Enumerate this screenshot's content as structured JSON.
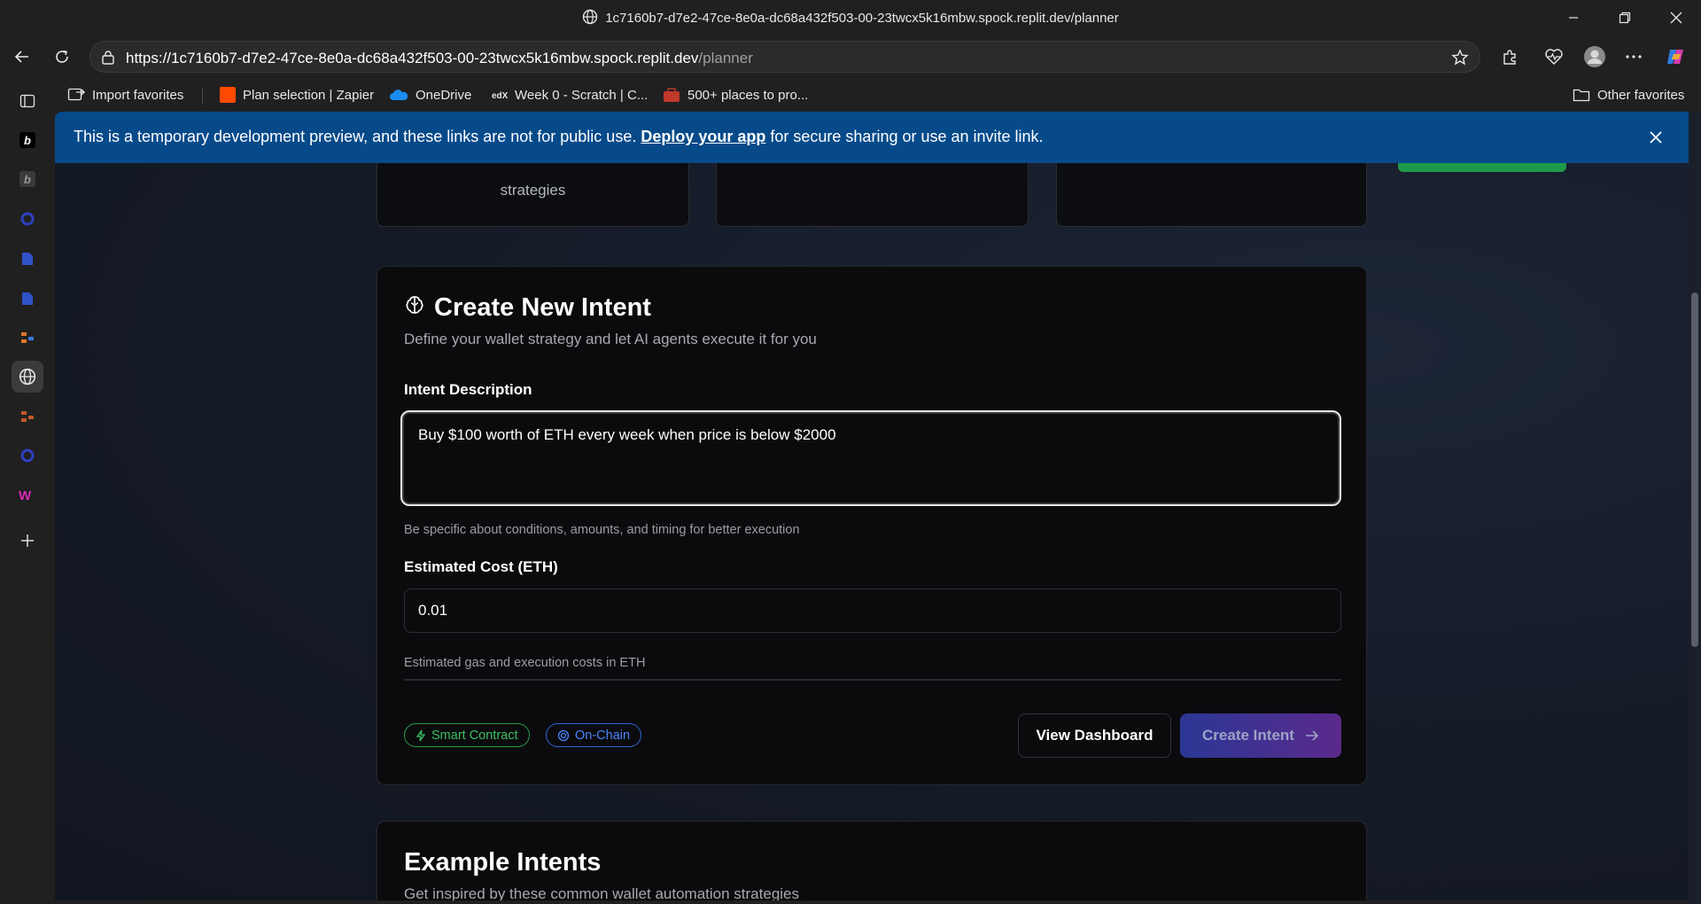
{
  "window": {
    "title": "1c7160b7-d7e2-47ce-8e0a-dc68a432f503-00-23twcx5k16mbw.spock.replit.dev/planner"
  },
  "address_bar": {
    "url_host": "https://1c7160b7-d7e2-47ce-8e0a-dc68a432f503-00-23twcx5k16mbw.spock.replit.dev",
    "url_path": "/planner"
  },
  "favorites": [
    {
      "label": "Import favorites",
      "icon": "import-icon"
    },
    {
      "label": "Plan selection | Zapier",
      "icon": "zapier-icon"
    },
    {
      "label": "OneDrive",
      "icon": "onedrive-icon"
    },
    {
      "label": "Week 0 - Scratch | C...",
      "icon": "edx-icon"
    },
    {
      "label": "500+ places to pro...",
      "icon": "briefcase-icon"
    }
  ],
  "other_favorites": "Other favorites",
  "banner": {
    "text_before": "This is a temporary development preview, and these links are not for public use.",
    "link": "Deploy your app",
    "text_after": "for secure sharing or use an invite link."
  },
  "top_cards": {
    "card1_text": "strategies"
  },
  "form": {
    "title": "Create New Intent",
    "subtitle": "Define your wallet strategy and let AI agents execute it for you",
    "intent_label": "Intent Description",
    "intent_value": "Buy $100 worth of ETH every week when price is below $2000",
    "intent_hint": "Be specific about conditions, amounts, and timing for better execution",
    "cost_label": "Estimated Cost (ETH)",
    "cost_value": "0.01",
    "cost_hint": "Estimated gas and execution costs in ETH",
    "badge_smart_contract": "Smart Contract",
    "badge_on_chain": "On-Chain",
    "view_dashboard": "View Dashboard",
    "create_intent": "Create Intent"
  },
  "examples": {
    "title": "Example Intents",
    "subtitle": "Get inspired by these common wallet automation strategies"
  },
  "colors": {
    "banner": "#064a8a",
    "badge_green": "#3cc063",
    "badge_blue": "#4a84ff",
    "create_gradient_start": "#2b3795",
    "create_gradient_end": "#5a2a8c"
  }
}
